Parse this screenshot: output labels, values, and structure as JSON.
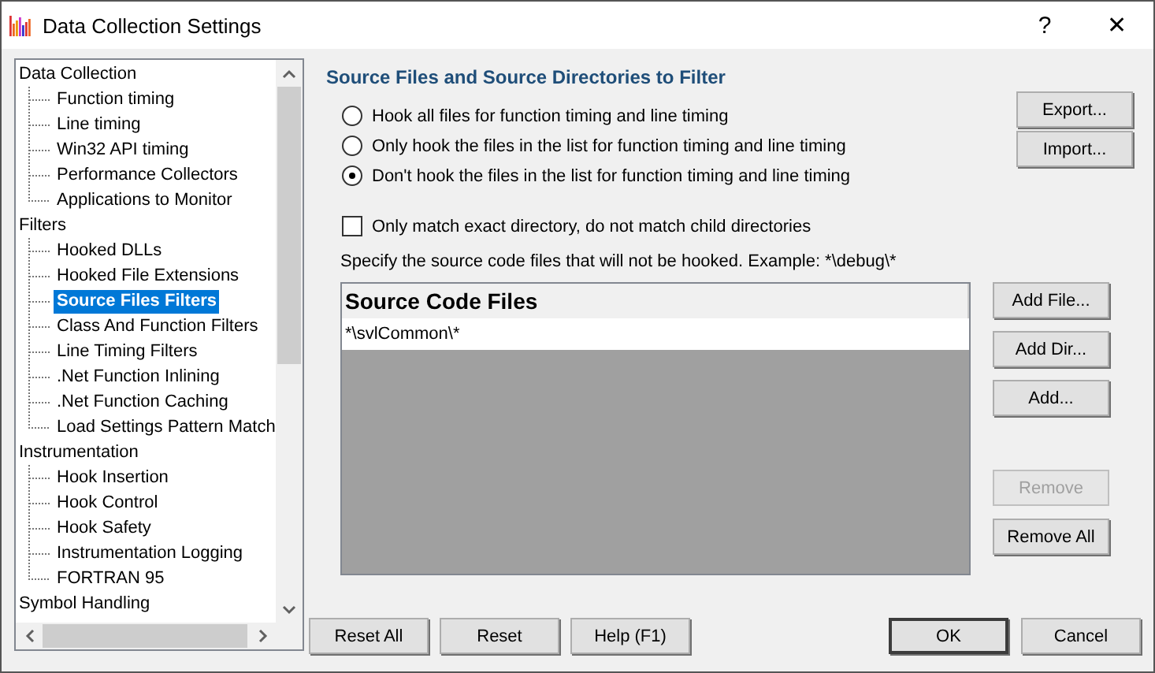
{
  "window": {
    "title": "Data Collection Settings",
    "help_glyph": "?",
    "close_glyph": "✕"
  },
  "tree": [
    {
      "label": "Data Collection",
      "selected": false,
      "children": [
        {
          "label": "Function timing",
          "selected": false
        },
        {
          "label": "Line timing",
          "selected": false
        },
        {
          "label": "Win32 API timing",
          "selected": false
        },
        {
          "label": "Performance Collectors",
          "selected": false
        },
        {
          "label": "Applications to Monitor",
          "selected": false
        }
      ]
    },
    {
      "label": "Filters",
      "selected": false,
      "children": [
        {
          "label": "Hooked DLLs",
          "selected": false
        },
        {
          "label": "Hooked File Extensions",
          "selected": false
        },
        {
          "label": "Source Files Filters",
          "selected": true
        },
        {
          "label": "Class And Function Filters",
          "selected": false
        },
        {
          "label": "Line Timing Filters",
          "selected": false
        },
        {
          "label": ".Net Function Inlining",
          "selected": false
        },
        {
          "label": ".Net Function Caching",
          "selected": false
        },
        {
          "label": "Load Settings Pattern Match",
          "selected": false
        }
      ]
    },
    {
      "label": "Instrumentation",
      "selected": false,
      "children": [
        {
          "label": "Hook Insertion",
          "selected": false
        },
        {
          "label": "Hook Control",
          "selected": false
        },
        {
          "label": "Hook Safety",
          "selected": false
        },
        {
          "label": "Instrumentation Logging",
          "selected": false
        },
        {
          "label": "FORTRAN 95",
          "selected": false
        }
      ]
    },
    {
      "label": "Symbol Handling",
      "selected": false
    }
  ],
  "heading": "Source Files and Source Directories to Filter",
  "radios": [
    {
      "label": "Hook all files for function timing and line timing",
      "selected": false
    },
    {
      "label": "Only hook the files in the list for function timing and line timing",
      "selected": false
    },
    {
      "label": "Don't hook the files in the list for function timing and line timing",
      "selected": true
    }
  ],
  "top_buttons": [
    {
      "label": "Export...",
      "disabled": false
    },
    {
      "label": "Import...",
      "disabled": false
    }
  ],
  "checkbox": {
    "label": "Only match exact directory, do not match child directories",
    "checked": false
  },
  "hint": "Specify the source code files that will not be hooked. Example: *\\debug\\*",
  "list": {
    "header": "Source Code Files",
    "rows": [
      "*\\svlCommon\\*"
    ]
  },
  "add_buttons": [
    {
      "label": "Add File...",
      "disabled": false
    },
    {
      "label": "Add Dir...",
      "disabled": false
    },
    {
      "label": "Add...",
      "disabled": false
    }
  ],
  "remove_buttons": [
    {
      "label": "Remove",
      "disabled": true
    },
    {
      "label": "Remove All",
      "disabled": false
    }
  ],
  "bottom_left_buttons": [
    {
      "label": "Reset All",
      "default": false
    },
    {
      "label": "Reset",
      "default": false
    },
    {
      "label": "Help (F1)",
      "default": false
    }
  ],
  "bottom_right_buttons": [
    {
      "label": "OK",
      "default": true
    },
    {
      "label": "Cancel",
      "default": false
    }
  ]
}
